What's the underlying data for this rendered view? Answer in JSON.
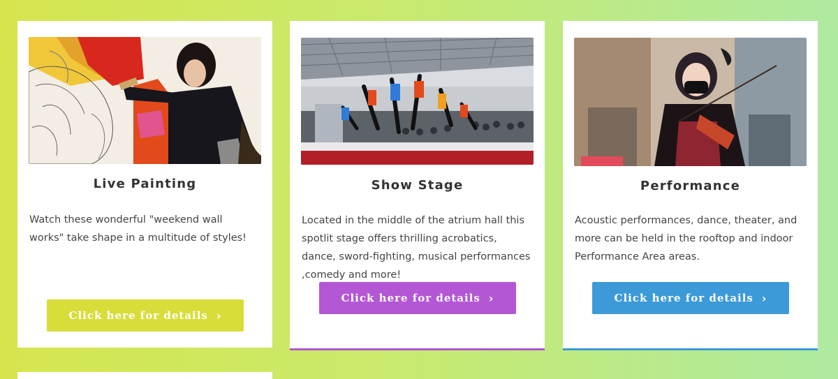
{
  "cards": [
    {
      "title": "Live Painting",
      "description": "Watch these wonderful \"weekend wall works\" take shape in a multitude of styles!",
      "button_label": "Click here for details",
      "button_color": "#d8dd3a"
    },
    {
      "title": "Show Stage",
      "description": "Located in the middle of the atrium hall this spotlit stage offers thrilling acrobatics, dance, sword-fighting, musical performances ,comedy and more!",
      "button_label": "Click here for details",
      "button_color": "#b357d4"
    },
    {
      "title": "Performance",
      "description": "Acoustic performances, dance, theater, and more can be held in the rooftop and indoor Performance Area areas.",
      "button_label": "Click here for details",
      "button_color": "#3c9ad8"
    }
  ],
  "icons": {
    "button_chevron": "chevron-right-icon",
    "chevron_glyph": "›"
  }
}
